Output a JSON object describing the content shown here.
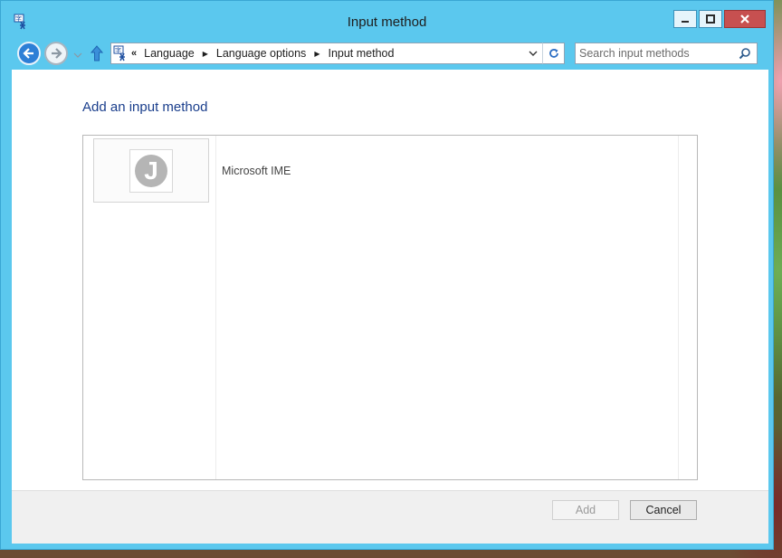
{
  "window": {
    "title": "Input method"
  },
  "navigation": {
    "breadcrumb": [
      "Language",
      "Language options",
      "Input method"
    ],
    "overflow_glyph": "«"
  },
  "search": {
    "placeholder": "Search input methods"
  },
  "main": {
    "heading": "Add an input method",
    "items": [
      {
        "label": "Microsoft IME",
        "icon": "ime-j-icon",
        "icon_letter": "J"
      }
    ]
  },
  "footer": {
    "add_label": "Add",
    "cancel_label": "Cancel"
  },
  "colors": {
    "title_bar": "#5bc8ee",
    "heading": "#1a3e8c",
    "close_button": "#c75050",
    "back_button": "#2d7fd6"
  }
}
